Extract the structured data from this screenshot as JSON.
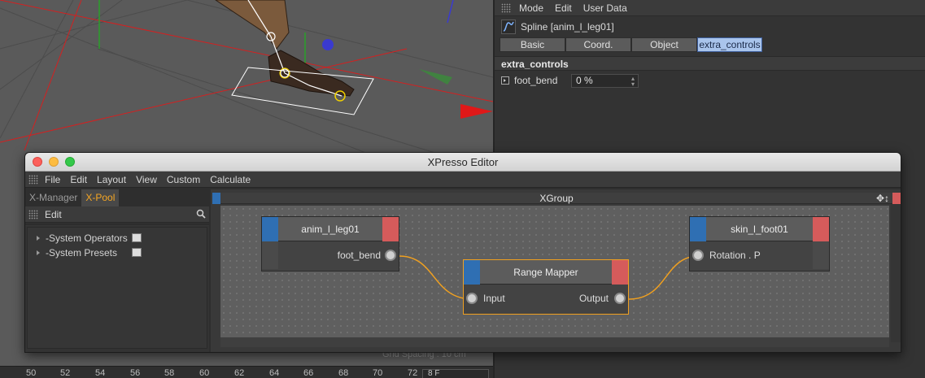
{
  "viewport": {
    "grid_spacing": "Grid Spacing : 10 cm"
  },
  "timeline": {
    "ticks": [
      "50",
      "52",
      "54",
      "56",
      "58",
      "60",
      "62",
      "64",
      "66",
      "68",
      "70",
      "72"
    ],
    "frame_value": "8 F"
  },
  "attribute_manager": {
    "menu": [
      "Mode",
      "Edit",
      "User Data"
    ],
    "object_title": "Spline [anim_l_leg01]",
    "tabs": [
      "Basic",
      "Coord.",
      "Object",
      "extra_controls"
    ],
    "active_tab": "extra_controls",
    "section": "extra_controls",
    "param": {
      "name": "foot_bend",
      "value": "0 %"
    }
  },
  "xpresso": {
    "window_title": "XPresso Editor",
    "menu": [
      "File",
      "Edit",
      "Layout",
      "View",
      "Custom",
      "Calculate"
    ],
    "pool_tabs": [
      "X-Manager",
      "X-Pool"
    ],
    "active_pool_tab": "X-Pool",
    "pool_toolbar": "Edit",
    "pool_items": [
      "-System Operators",
      "-System Presets"
    ],
    "group_title": "XGroup",
    "nodes": {
      "anim": {
        "title": "anim_l_leg01",
        "port": "foot_bend"
      },
      "mapper": {
        "title": "Range Mapper",
        "input": "Input",
        "output": "Output"
      },
      "skin": {
        "title": "skin_l_foot01",
        "port": "Rotation . P"
      }
    },
    "wire_color": "#f0a020"
  },
  "colors": {
    "input_port": "#2f6fb3",
    "output_port": "#d55b5b",
    "active_tab": "#a9c4ec",
    "pool_active_tab": "#f5a623"
  }
}
